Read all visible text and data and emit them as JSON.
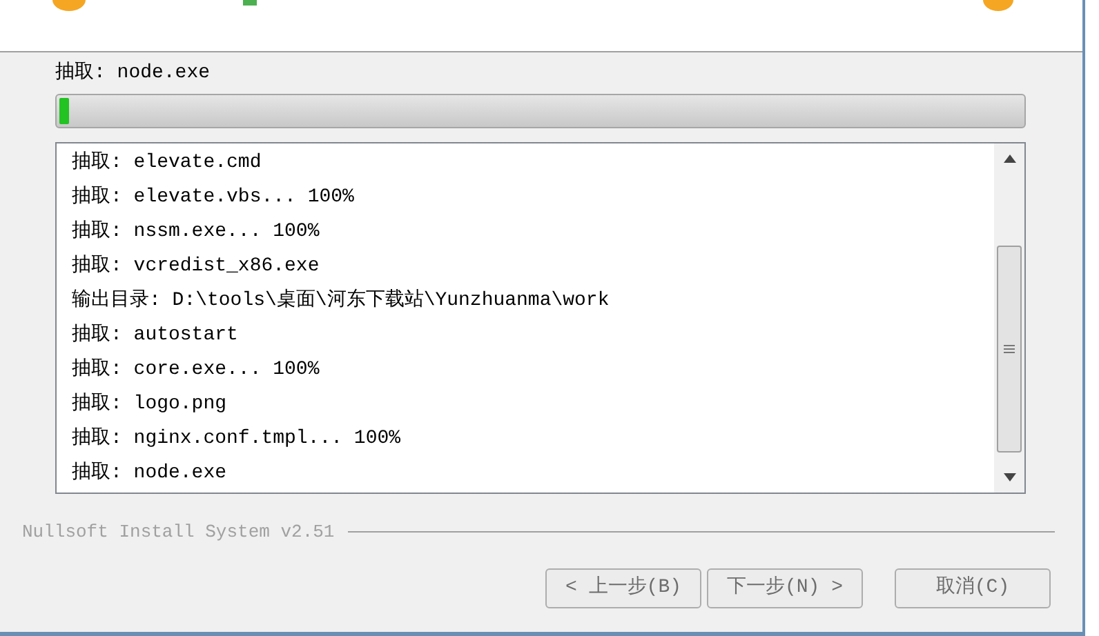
{
  "status_text": "抽取: node.exe",
  "progress": {
    "level": 0.01
  },
  "log": [
    "抽取: elevate.cmd",
    "抽取: elevate.vbs... 100%",
    "抽取: nssm.exe... 100%",
    "抽取: vcredist_x86.exe",
    "输出目录: D:\\tools\\桌面\\河东下载站\\Yunzhuanma\\work",
    "抽取: autostart",
    "抽取: core.exe... 100%",
    "抽取: logo.png",
    "抽取: nginx.conf.tmpl... 100%",
    "抽取: node.exe"
  ],
  "branding": "Nullsoft Install System v2.51",
  "buttons": [
    {
      "label": "< 上一步(B)",
      "disabled": true
    },
    {
      "label": "下一步(N) >",
      "disabled": true
    },
    {
      "label": "取消(C)",
      "disabled": true
    }
  ]
}
